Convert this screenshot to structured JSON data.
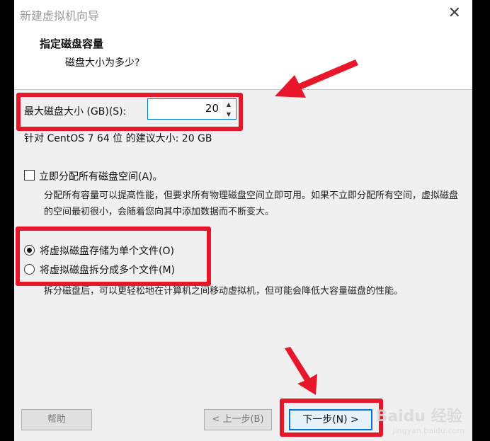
{
  "window": {
    "title": "新建虚拟机向导"
  },
  "header": {
    "title": "指定磁盘容量",
    "subtitle": "磁盘大小为多少?"
  },
  "disk_size": {
    "label": "最大磁盘大小 (GB)(S):",
    "value": "20"
  },
  "recommendation": "针对 CentOS 7 64 位 的建议大小: 20 GB",
  "allocate": {
    "label": "立即分配所有磁盘空间(A)。",
    "checked": false,
    "description": "分配所有容量可以提高性能，但要求所有物理磁盘空间立即可用。如果不立即分配所有空间，虚拟磁盘的空间最初很小，会随着您向其中添加数据而不断变大。"
  },
  "storage": {
    "single_file_label": "将虚拟磁盘存储为单个文件(O)",
    "multi_file_label": "将虚拟磁盘拆分成多个文件(M)",
    "selected": "single",
    "description": "拆分磁盘后，可以更轻松地在计算机之间移动虚拟机，但可能会降低大容量磁盘的性能。"
  },
  "buttons": {
    "help": "帮助",
    "back": "< 上一步(B)",
    "next": "下一步(N) >"
  },
  "watermark": {
    "main": "Baidu 经验",
    "sub": "jingyan.baidu.com"
  },
  "colors": {
    "highlight": "#e8162a",
    "accent": "#0078d7"
  }
}
